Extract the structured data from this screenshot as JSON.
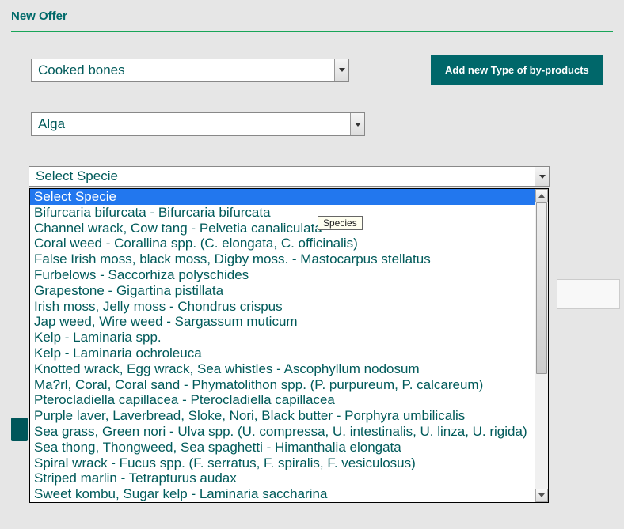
{
  "title": "New Offer",
  "select1": {
    "value": "Cooked bones"
  },
  "add_button_label": "Add new Type of by-products",
  "select2": {
    "value": "Alga"
  },
  "select3": {
    "value": "Select Specie"
  },
  "tooltip": "Species",
  "dropdown_items": [
    "Select Specie",
    "Bifurcaria bifurcata - Bifurcaria bifurcata",
    "Channel wrack, Cow tang - Pelvetia canaliculata",
    "Coral weed - Corallina spp. (C. elongata, C. officinalis)",
    "False Irish moss, black moss, Digby moss. - Mastocarpus stellatus",
    "Furbelows - Saccorhiza polyschides",
    "Grapestone - Gigartina pistillata",
    "Irish moss, Jelly moss - Chondrus crispus",
    "Jap weed, Wire weed - Sargassum muticum",
    "Kelp - Laminaria spp.",
    "Kelp - Laminaria ochroleuca",
    "Knotted wrack, Egg wrack, Sea whistles - Ascophyllum nodosum",
    "Ma?rl, Coral, Coral sand - Phymatolithon spp. (P. purpureum, P. calcareum)",
    "Pterocladiella capillacea - Pterocladiella capillacea",
    "Purple laver, Laverbread, Sloke, Nori, Black butter - Porphyra umbilicalis",
    "Sea grass, Green nori - Ulva spp. (U. compressa, U. intestinalis, U. linza, U. rigida)",
    "Sea thong, Thongweed, Sea spaghetti - Himanthalia elongata",
    "Spiral wrack - Fucus spp. (F. serratus, F. spiralis, F. vesiculosus)",
    "Striped marlin - Tetrapturus audax",
    "Sweet kombu, Sugar kelp - Laminaria saccharina"
  ],
  "dropdown_selected_index": 0
}
